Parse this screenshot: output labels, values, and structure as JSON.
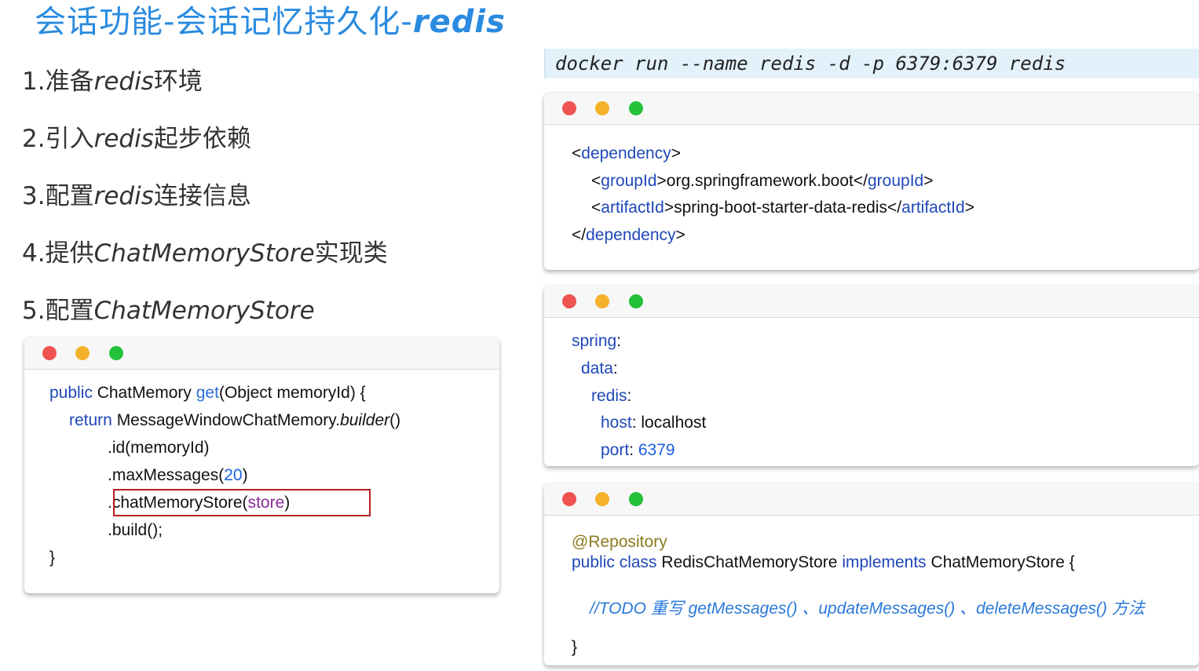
{
  "title": {
    "zh": "会话功能-会话记忆持久化-",
    "en": "redis"
  },
  "steps": [
    {
      "num": "1.",
      "a": "准备",
      "en": "redis",
      "b": "环境"
    },
    {
      "num": "2.",
      "a": "引入",
      "en": "redis",
      "b": "起步依赖"
    },
    {
      "num": "3.",
      "a": "配置",
      "en": "redis",
      "b": "连接信息"
    },
    {
      "num": "4.",
      "a": "提供",
      "en": "ChatMemoryStore",
      "b": "实现类"
    },
    {
      "num": "5.",
      "a": "配置",
      "en": "ChatMemoryStore",
      "b": ""
    }
  ],
  "docker_command": "docker run --name redis -d -p 6379:6379 redis",
  "java_card": {
    "l1_kw": "public",
    "l1_type": " ChatMemory ",
    "l1_fn": "get",
    "l1_rest": "(Object memoryId) {",
    "l2_kw": "return",
    "l2_a": " MessageWindowChatMemory.",
    "l2_b": "builder",
    "l2_c": "()",
    "l3": ".id(memoryId)",
    "l4_a": ".maxMessages(",
    "l4_num": "20",
    "l4_b": ")",
    "l5_a": ".chatMemoryStore(",
    "l5_arg": "store",
    "l5_b": ")",
    "l6": ".build();",
    "l7": "}"
  },
  "xml_card": {
    "open_lt": "<",
    "dependency": "dependency",
    "gt": ">",
    "groupId": "groupId",
    "group_value": "org.springframework.boot",
    "artifactId": "artifactId",
    "artifact_value": "spring-boot-starter-data-redis",
    "close_lt": "</"
  },
  "yaml_card": {
    "spring": "spring",
    "data": "data",
    "redis": "redis",
    "host_key": "host",
    "host_value": "localhost",
    "port_key": "port",
    "port_value": "6379",
    "colon": ":"
  },
  "repo_card": {
    "annotation": "@Repository",
    "kw_public_class": "public class",
    "class_name": " RedisChatMemoryStore ",
    "kw_implements": "implements",
    "iface": " ChatMemoryStore {",
    "comment": "//TODO 重写 getMessages() 、updateMessages() 、deleteMessages() 方法",
    "close": "}"
  },
  "colors": {
    "title": "#2a8be0",
    "keyword": "#1f47b8",
    "highlight_border": "#b91c1c",
    "docker_bg": "#e3f1fa"
  }
}
